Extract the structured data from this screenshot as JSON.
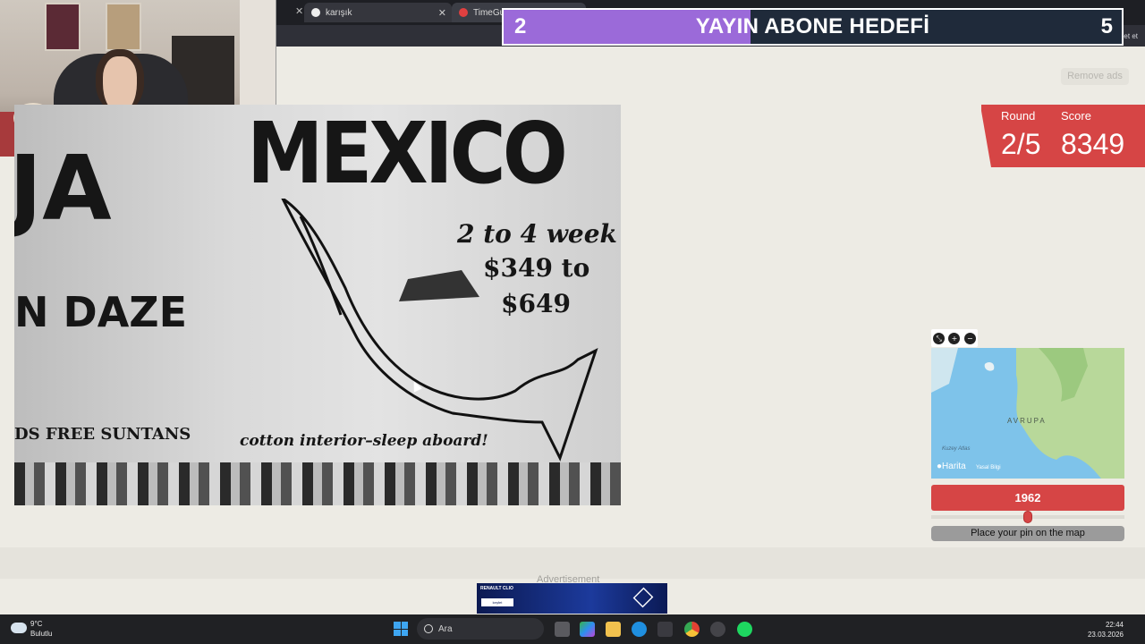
{
  "browser": {
    "tabs": [
      {
        "title": "karışık",
        "close": "✕"
      },
      {
        "title": "TimeGues",
        "close": "✕"
      }
    ],
    "first_tab_close": "✕",
    "toolbar_label": "Sohbet et"
  },
  "overlay": {
    "subscribe_goal": {
      "current": "2",
      "title": "YAYIN ABONE HEDEFİ",
      "target": "5",
      "progress_fraction": 0.4,
      "fill_color": "#9b6ad9"
    }
  },
  "game": {
    "remove_ads_label": "Remove ads",
    "round_label": "Round",
    "round_value": "2/5",
    "score_label": "Score",
    "score_value": "8349",
    "accent_color": "#d64545",
    "photo": {
      "title_text": "MEXICO",
      "headline_left": "JA",
      "duration": "2 to 4 week",
      "price_low": "$349 to",
      "price_high": "$649",
      "daze": "N DAZE",
      "suntans": "DS   FREE SUNTANS",
      "cotton": "cotton interior–sleep aboard!"
    },
    "map": {
      "controls": [
        "⤡",
        "+",
        "−"
      ],
      "continent_label": "AVRUPA",
      "ocean_label": "Kuzey Atlas",
      "attribution": "Harita",
      "legal": "Yasal Bilgi"
    },
    "year": {
      "value": "1962",
      "slider_fraction": 0.5
    },
    "place_pin_label": "Place your pin on the map"
  },
  "ad": {
    "label": "Advertisement",
    "brand": "RENAULT CLIO",
    "cta": "keşfet"
  },
  "taskbar": {
    "weather_temp": "9°C",
    "weather_desc": "Bulutlu",
    "search_placeholder": "Ara",
    "time": "22:44",
    "date": "23.03.2026"
  }
}
